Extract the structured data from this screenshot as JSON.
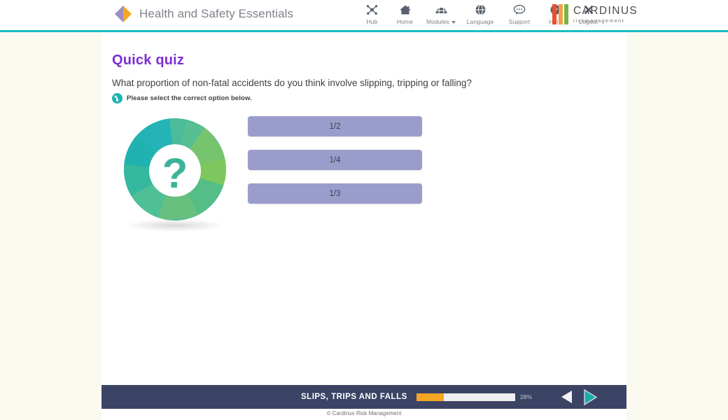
{
  "header": {
    "brand_title": "Health and Safety Essentials",
    "brand_logo_icon": "diamond-logo-icon",
    "diamond_left_color": "#9b8ec4",
    "diamond_right_color": "#f5a623",
    "nav_items": [
      {
        "label": "Hub",
        "icon": "hub-network-icon",
        "has_caret": false
      },
      {
        "label": "Home",
        "icon": "home-house-icon",
        "has_caret": false
      },
      {
        "label": "Modules",
        "icon": "modules-grid-icon",
        "has_caret": true
      },
      {
        "label": "Language",
        "icon": "globe-icon",
        "has_caret": false
      },
      {
        "label": "Support",
        "icon": "speech-bubble-icon",
        "has_caret": false
      },
      {
        "label": "Help",
        "icon": "question-circle-icon",
        "has_caret": false
      },
      {
        "label": "Logout",
        "icon": "close-x-icon",
        "has_caret": false
      }
    ],
    "cardinus": {
      "name": "CARDINUS",
      "subtitle": "riskmanagement",
      "bar_colors": [
        "#e8502f",
        "#f0a04b",
        "#7cb342"
      ]
    },
    "rule_color": "#17bfc0"
  },
  "main": {
    "title": "Quick quiz",
    "title_color": "#7b2fd4",
    "question": "What proportion of non-fatal accidents do you think involve slipping, tripping or falling?",
    "instruction": "Please select the correct option below.",
    "instruction_icon": "click-hand-icon",
    "graphic_icon": "question-mark-donut-icon",
    "options": [
      {
        "label": "1/2"
      },
      {
        "label": "1/4"
      },
      {
        "label": "1/3"
      }
    ],
    "option_color": "#9a9dcb"
  },
  "bottom_bar": {
    "module_name": "SLIPS, TRIPS AND FALLS",
    "progress_percent": 28,
    "progress_label": "28%",
    "progress_fill_color": "#f5a623",
    "prev_icon": "previous-arrow-icon",
    "next_icon": "next-arrow-icon",
    "bar_color": "#3b4465"
  },
  "footer": {
    "copyright_mark": "©",
    "copyright_text": "Cardinus Risk Management"
  }
}
